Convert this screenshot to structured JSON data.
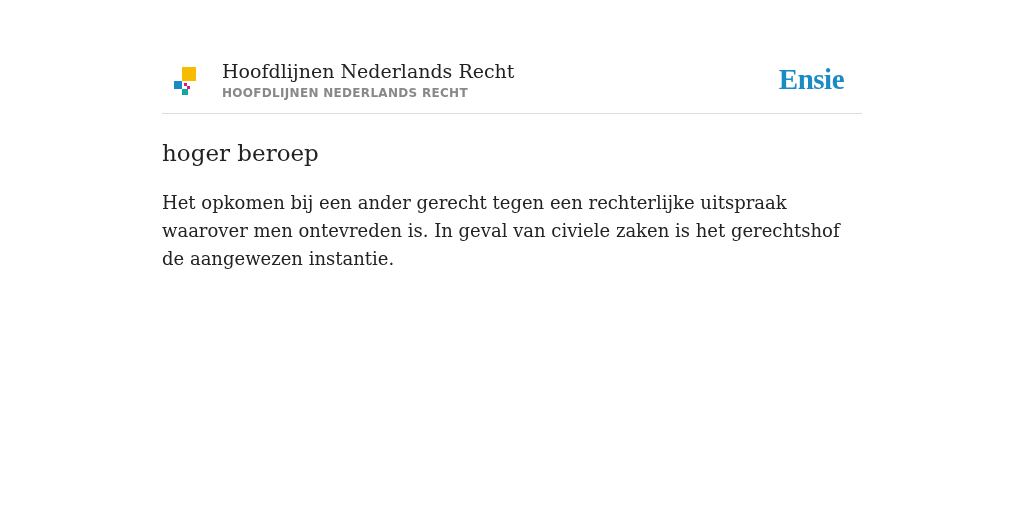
{
  "header": {
    "title": "Hoofdlijnen Nederlands Recht",
    "subtitle": "HOOFDLIJNEN NEDERLANDS RECHT",
    "brand": "Ensie"
  },
  "entry": {
    "term": "hoger beroep",
    "definition": "Het opkomen bij een ander gerecht tegen een rechterlijke uitspraak waarover men ontevreden is. In geval van civiele zaken is het gerechtshof de aangewezen instantie."
  }
}
